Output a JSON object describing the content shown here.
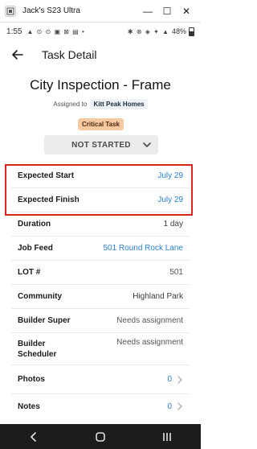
{
  "window": {
    "title": "Jack's S23 Ultra",
    "minimize": "—",
    "maximize": "☐",
    "close": "✕"
  },
  "status_bar": {
    "time": "1:55",
    "left_glyphs": "▲ ⊙ ⊙ ▣ ⊠ ▤ •",
    "right_glyphs": "✱ ⊗ ◈ ✦ ▲",
    "battery": "48%"
  },
  "header": {
    "title": "Task Detail"
  },
  "task": {
    "title": "City Inspection - Frame",
    "assigned_prefix": "Assigned to",
    "assigned_company": "Kitt Peak Homes",
    "priority_badge": "Critical Task",
    "status": "NOT STARTED"
  },
  "details": [
    {
      "label": "Expected Start",
      "value": "July 29"
    },
    {
      "label": "Expected Finish",
      "value": "July 29"
    },
    {
      "label": "Duration",
      "value": "1 day"
    },
    {
      "label": "Job Feed",
      "value": "501 Round Rock Lane"
    },
    {
      "label": "LOT #",
      "value": "501"
    },
    {
      "label": "Community",
      "value": "Highland Park"
    },
    {
      "label": "Builder Super",
      "value": "Needs assignment"
    },
    {
      "label": "Builder Scheduler",
      "value": "Needs assignment"
    },
    {
      "label": "Photos",
      "value": "0"
    },
    {
      "label": "Notes",
      "value": "0"
    }
  ],
  "colors": {
    "accent_blue": "#2a7fd1",
    "highlight_red": "#d9231d",
    "badge_orange": "#f7c9a0"
  }
}
